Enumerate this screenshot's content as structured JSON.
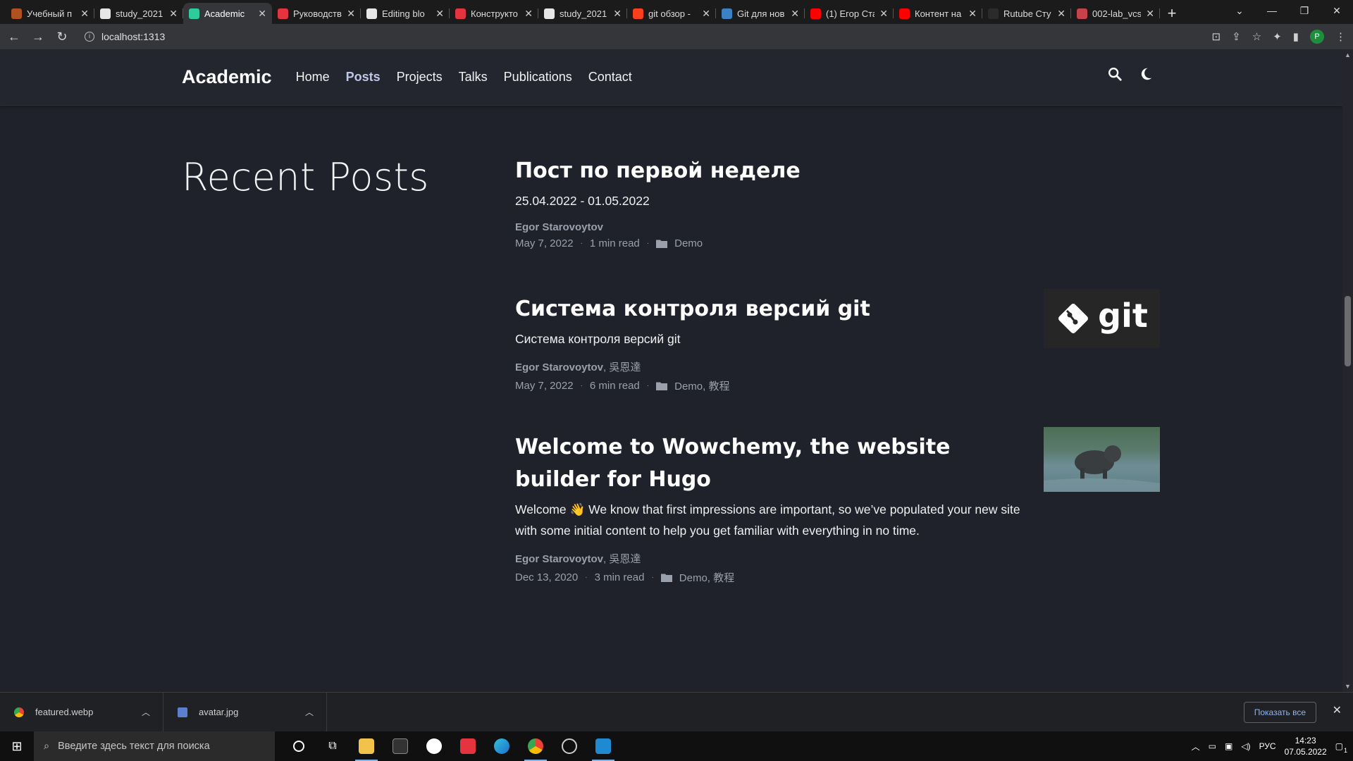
{
  "browser": {
    "tabs": [
      {
        "label": "Учебный п",
        "color": "#b0521f",
        "active": false
      },
      {
        "label": "study_2021",
        "color": "#e6e6e6",
        "active": false
      },
      {
        "label": "Academic",
        "color": "#2ecc9a",
        "active": true
      },
      {
        "label": "Руководств",
        "color": "#e5343f",
        "active": false
      },
      {
        "label": "Editing blo",
        "color": "#e6e6e6",
        "active": false
      },
      {
        "label": "Конструкто",
        "color": "#e5343f",
        "active": false
      },
      {
        "label": "study_2021",
        "color": "#e6e6e6",
        "active": false
      },
      {
        "label": "git обзор -",
        "color": "#fc3f1d",
        "active": false
      },
      {
        "label": "Git для нов",
        "color": "#3b82c4",
        "active": false
      },
      {
        "label": "(1) Егор Ста",
        "color": "#ff0000",
        "active": false
      },
      {
        "label": "Контент на",
        "color": "#ff0000",
        "active": false
      },
      {
        "label": "Rutube Сту",
        "color": "#2b2b2b",
        "active": false
      },
      {
        "label": "002-lab_vcs",
        "color": "#c7424b",
        "active": false
      }
    ],
    "new_tab": "+",
    "url": "localhost:1313"
  },
  "site": {
    "brand": "Academic",
    "menu": [
      "Home",
      "Posts",
      "Projects",
      "Talks",
      "Publications",
      "Contact"
    ],
    "active_menu": "Posts"
  },
  "page": {
    "section_title": "Recent Posts",
    "posts": [
      {
        "title": "Пост по первой неделе",
        "summary": "25.04.2022 - 01.05.2022",
        "author": "Egor Starovoytov",
        "co_author": "",
        "date": "May 7, 2022",
        "read_time": "1 min read",
        "categories": "Demo",
        "image": "none"
      },
      {
        "title": "Система контроля версий git",
        "summary": "Система контроля версий git",
        "author": "Egor Starovoytov",
        "co_author": ", 吳恩達",
        "date": "May 7, 2022",
        "read_time": "6 min read",
        "categories": "Demo, 教程",
        "image": "git-logo"
      },
      {
        "title": "Welcome to Wowchemy, the website builder for Hugo",
        "summary": "Welcome 👋 We know that first impressions are important, so we’ve populated your new site with some initial content to help you get familiar with everything in no time.",
        "author": "Egor Starovoytov",
        "co_author": ", 吳恩達",
        "date": "Dec 13, 2020",
        "read_time": "3 min read",
        "categories": "Demo, 教程",
        "image": "dog-photo"
      }
    ],
    "git_logo_text": "git"
  },
  "downloads": {
    "items": [
      {
        "name": "featured.webp"
      },
      {
        "name": "avatar.jpg"
      }
    ],
    "show_all": "Показать все"
  },
  "taskbar": {
    "search_placeholder": "Введите здесь текст для поиска",
    "lang": "РУС",
    "time": "14:23",
    "date": "07.05.2022",
    "notification_count": "1"
  }
}
